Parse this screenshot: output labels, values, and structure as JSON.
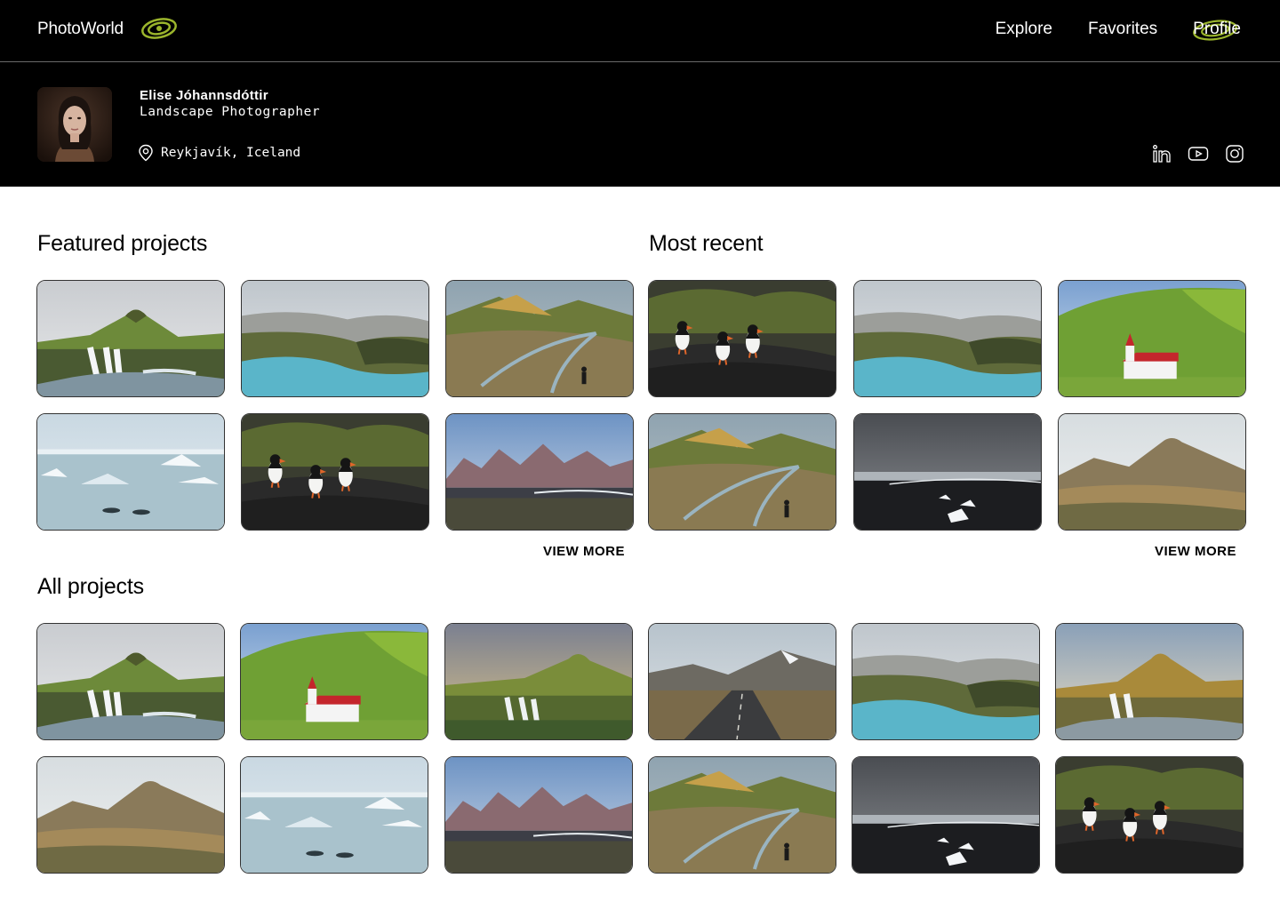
{
  "header": {
    "brand": "PhotoWorld",
    "logo_icon": "orbit-eye-logo-icon",
    "accent": "#9bb52c",
    "nav": [
      {
        "label": "Explore",
        "active": false
      },
      {
        "label": "Favorites",
        "active": false
      },
      {
        "label": "Profile",
        "active": true
      }
    ]
  },
  "profile": {
    "name": "Elise Jóhannsdóttir",
    "role": "Landscape Photographer",
    "location": "Reykjavík, Iceland",
    "location_icon": "map-pin-icon",
    "socials": [
      {
        "icon": "linkedin-icon"
      },
      {
        "icon": "youtube-icon"
      },
      {
        "icon": "instagram-icon"
      }
    ]
  },
  "featured": {
    "title": "Featured projects",
    "view_more": "VIEW MORE",
    "photos": [
      "waterfall-mountain",
      "blue-lagoon",
      "river-valley-hiker",
      "glacier-lagoon",
      "puffins",
      "black-beach-mountains"
    ]
  },
  "recent": {
    "title": "Most recent",
    "view_more": "VIEW MORE",
    "photos": [
      "puffins",
      "blue-lagoon",
      "red-roof-church",
      "river-valley-hiker",
      "ice-beach",
      "rhyolite-hills"
    ]
  },
  "all": {
    "title": "All projects",
    "photos": [
      "waterfall-mountain",
      "red-roof-church",
      "waterfall-sunset",
      "mountain-road",
      "blue-lagoon",
      "waterfall-golden",
      "rhyolite-hills",
      "glacier-lagoon",
      "black-beach-mountains",
      "river-valley-hiker",
      "ice-beach",
      "puffins"
    ]
  }
}
